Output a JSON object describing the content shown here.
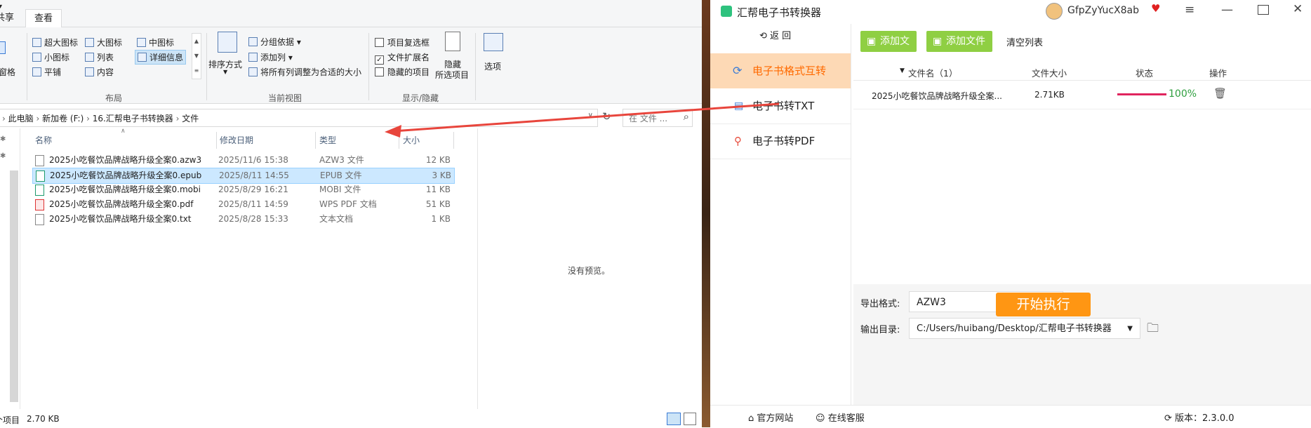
{
  "explorer": {
    "tabs": {
      "share": "共享",
      "view": "查看"
    },
    "ribbon": {
      "pane_label": "窗格",
      "layout": {
        "items": [
          "超大图标",
          "大图标",
          "中图标",
          "小图标",
          "列表",
          "详细信息",
          "平铺",
          "内容"
        ],
        "title": "布局"
      },
      "current_view": {
        "sort": "排序方式",
        "group_by": "分组依据",
        "add_column": "添加列",
        "fit_columns": "将所有列调整为合适的大小",
        "title": "当前视图"
      },
      "show_hide": {
        "item_checkboxes": "项目复选框",
        "file_extensions": "文件扩展名",
        "hidden_items": "隐藏的项目",
        "hide_selected_1": "隐藏",
        "hide_selected_2": "所选项目",
        "title": "显示/隐藏",
        "checked": {
          "item_checkboxes": false,
          "file_extensions": true,
          "hidden_items": false
        }
      },
      "options": "选项"
    },
    "address": [
      "此电脑",
      "新加卷 (F:)",
      "16.汇帮电子书转换器",
      "文件"
    ],
    "search_placeholder": "在 文件 ...",
    "columns": {
      "name": "名称",
      "date": "修改日期",
      "type": "类型",
      "size": "大小"
    },
    "files": [
      {
        "name": "2025小吃餐饮品牌战略升级全案0.azw3",
        "date": "2025/11/6 15:38",
        "type": "AZW3 文件",
        "size": "12 KB"
      },
      {
        "name": "2025小吃餐饮品牌战略升级全案0.epub",
        "date": "2025/8/11 14:55",
        "type": "EPUB 文件",
        "size": "3 KB"
      },
      {
        "name": "2025小吃餐饮品牌战略升级全案0.mobi",
        "date": "2025/8/29 16:21",
        "type": "MOBI 文件",
        "size": "11 KB"
      },
      {
        "name": "2025小吃餐饮品牌战略升级全案0.pdf",
        "date": "2025/8/11 14:59",
        "type": "WPS PDF 文档",
        "size": "51 KB"
      },
      {
        "name": "2025小吃餐饮品牌战略升级全案0.txt",
        "date": "2025/8/28 15:33",
        "type": "文本文档",
        "size": "1 KB"
      }
    ],
    "preview_text": "没有预览。",
    "status": {
      "selected_label": "个项目",
      "size": "2.70 KB"
    }
  },
  "converter": {
    "title": "汇帮电子书转换器",
    "username": "GfpZyYucX8ab",
    "back": "返 回",
    "nav": [
      "电子书格式互转",
      "电子书转TXT",
      "电子书转PDF"
    ],
    "toolbar": {
      "add_file": "添加文件",
      "add_folder": "添加文件夹",
      "clear": "清空列表"
    },
    "table": {
      "headers": {
        "name": "文件名（1）",
        "size": "文件大小",
        "status": "状态",
        "action": "操作"
      },
      "rows": [
        {
          "name": "2025小吃餐饮品牌战略升级全案...",
          "size": "2.71KB",
          "progress": 1.0,
          "progress_text": "100%"
        }
      ]
    },
    "export_format_label": "导出格式:",
    "export_format_value": "AZW3",
    "output_dir_label": "输出目录:",
    "output_dir_value": "C:/Users/huibang/Desktop/汇帮电子书转换器",
    "start_button": "开始执行",
    "footer": {
      "website": "官方网站",
      "support": "在线客服",
      "version": "版本：2.3.0.0"
    },
    "colors": {
      "accent_orange": "#ff9613",
      "nav_active": "#fdd9b5",
      "green": "#8fcf43",
      "progress": "#e0245e"
    }
  }
}
